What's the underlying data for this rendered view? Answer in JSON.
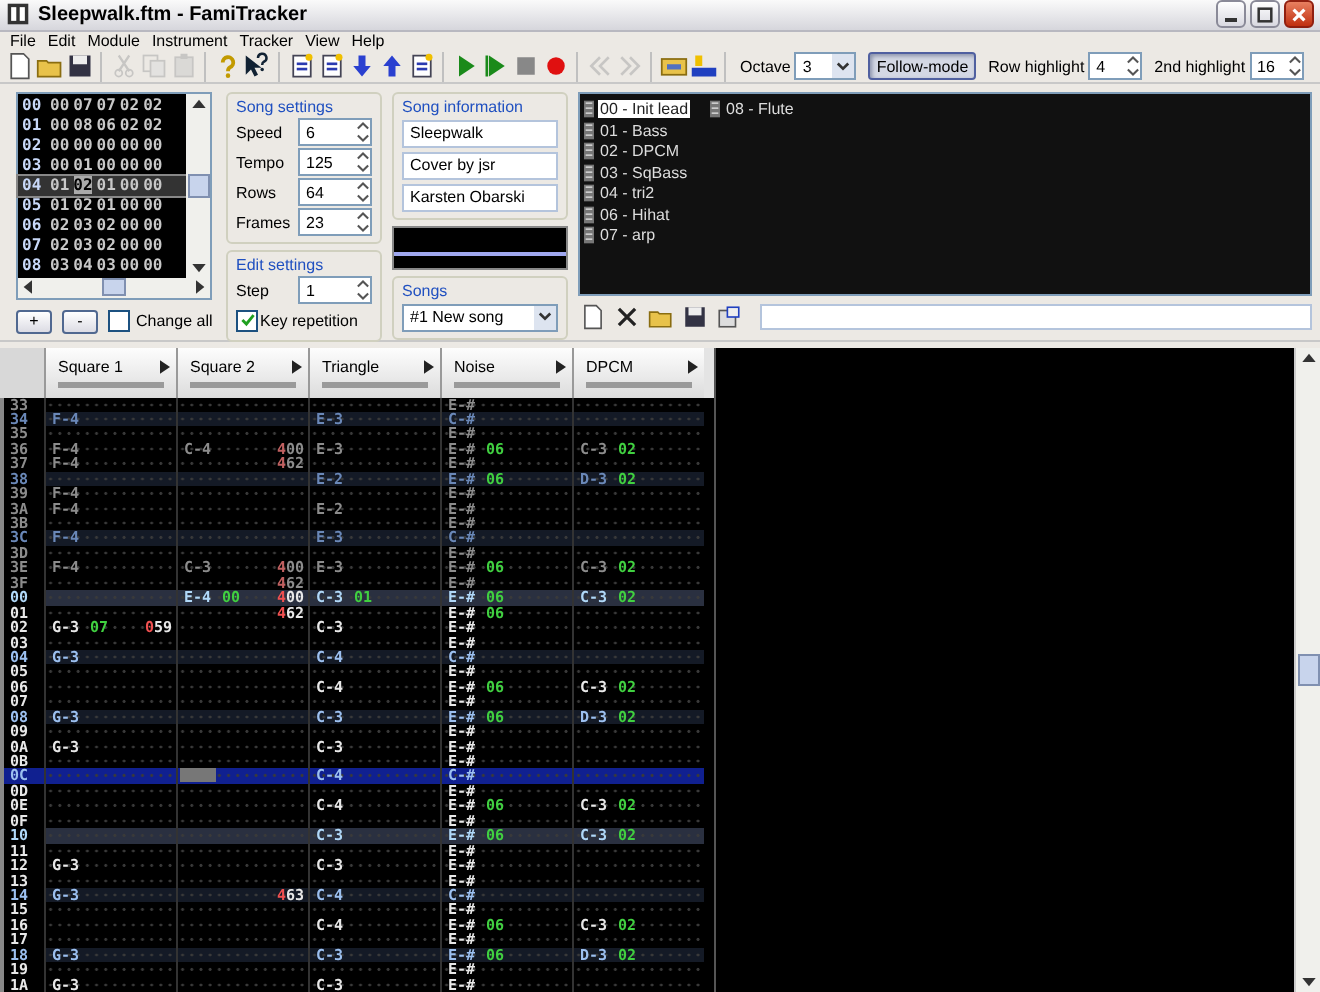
{
  "window": {
    "title": "Sleepwalk.ftm - FamiTracker"
  },
  "menu": [
    "File",
    "Edit",
    "Module",
    "Instrument",
    "Tracker",
    "View",
    "Help"
  ],
  "toolbar": {
    "groups": [
      [
        {
          "kind": "new",
          "disabled": false
        },
        {
          "kind": "open",
          "disabled": false
        },
        {
          "kind": "save",
          "disabled": false
        }
      ],
      [
        {
          "kind": "cut",
          "disabled": true
        },
        {
          "kind": "copy",
          "disabled": true
        },
        {
          "kind": "paste",
          "disabled": true
        }
      ],
      [
        {
          "kind": "about",
          "disabled": false
        },
        {
          "kind": "context-help",
          "disabled": false
        }
      ],
      [
        {
          "kind": "insert-frame",
          "disabled": false
        },
        {
          "kind": "remove-frame",
          "disabled": false
        },
        {
          "kind": "move-down",
          "disabled": false
        },
        {
          "kind": "move-up",
          "disabled": false
        },
        {
          "kind": "duplicate",
          "disabled": false
        }
      ],
      [
        {
          "kind": "play",
          "disabled": false
        },
        {
          "kind": "play-pattern",
          "disabled": false
        },
        {
          "kind": "stop",
          "disabled": false
        },
        {
          "kind": "record",
          "disabled": false
        }
      ],
      [
        {
          "kind": "previous",
          "disabled": true
        },
        {
          "kind": "next",
          "disabled": true
        }
      ],
      [
        {
          "kind": "settings",
          "disabled": false
        },
        {
          "kind": "sample",
          "disabled": false
        }
      ]
    ],
    "octave": {
      "label": "Octave",
      "value": "3"
    },
    "follow_mode": {
      "label": "Follow-mode",
      "on": true
    },
    "row_highlight": {
      "label": "Row highlight",
      "value": "4"
    },
    "second_highlight": {
      "label": "2nd highlight",
      "value": "16"
    }
  },
  "frames": {
    "rows": [
      {
        "number": "00",
        "selected": false,
        "cells": [
          {
            "value": "00",
            "cursor": false
          },
          {
            "value": "07",
            "cursor": false
          },
          {
            "value": "07",
            "cursor": false
          },
          {
            "value": "02",
            "cursor": false
          },
          {
            "value": "02",
            "cursor": false
          }
        ]
      },
      {
        "number": "01",
        "selected": false,
        "cells": [
          {
            "value": "00",
            "cursor": false
          },
          {
            "value": "08",
            "cursor": false
          },
          {
            "value": "06",
            "cursor": false
          },
          {
            "value": "02",
            "cursor": false
          },
          {
            "value": "02",
            "cursor": false
          }
        ]
      },
      {
        "number": "02",
        "selected": false,
        "cells": [
          {
            "value": "00",
            "cursor": false
          },
          {
            "value": "00",
            "cursor": false
          },
          {
            "value": "00",
            "cursor": false
          },
          {
            "value": "00",
            "cursor": false
          },
          {
            "value": "00",
            "cursor": false
          }
        ]
      },
      {
        "number": "03",
        "selected": false,
        "cells": [
          {
            "value": "00",
            "cursor": false
          },
          {
            "value": "01",
            "cursor": false
          },
          {
            "value": "00",
            "cursor": false
          },
          {
            "value": "00",
            "cursor": false
          },
          {
            "value": "00",
            "cursor": false
          }
        ]
      },
      {
        "number": "04",
        "selected": true,
        "cells": [
          {
            "value": "01",
            "cursor": false
          },
          {
            "value": "02",
            "cursor": true
          },
          {
            "value": "01",
            "cursor": false
          },
          {
            "value": "00",
            "cursor": false
          },
          {
            "value": "00",
            "cursor": false
          }
        ]
      },
      {
        "number": "05",
        "selected": false,
        "cells": [
          {
            "value": "01",
            "cursor": false
          },
          {
            "value": "02",
            "cursor": false
          },
          {
            "value": "01",
            "cursor": false
          },
          {
            "value": "00",
            "cursor": false
          },
          {
            "value": "00",
            "cursor": false
          }
        ]
      },
      {
        "number": "06",
        "selected": false,
        "cells": [
          {
            "value": "02",
            "cursor": false
          },
          {
            "value": "03",
            "cursor": false
          },
          {
            "value": "02",
            "cursor": false
          },
          {
            "value": "00",
            "cursor": false
          },
          {
            "value": "00",
            "cursor": false
          }
        ]
      },
      {
        "number": "07",
        "selected": false,
        "cells": [
          {
            "value": "02",
            "cursor": false
          },
          {
            "value": "03",
            "cursor": false
          },
          {
            "value": "02",
            "cursor": false
          },
          {
            "value": "00",
            "cursor": false
          },
          {
            "value": "00",
            "cursor": false
          }
        ]
      },
      {
        "number": "08",
        "selected": false,
        "cells": [
          {
            "value": "03",
            "cursor": false
          },
          {
            "value": "04",
            "cursor": false
          },
          {
            "value": "03",
            "cursor": false
          },
          {
            "value": "00",
            "cursor": false
          },
          {
            "value": "00",
            "cursor": false
          }
        ]
      }
    ],
    "add_button": "+",
    "remove_button": "-",
    "change_all": {
      "label": "Change all",
      "checked": false
    }
  },
  "song_settings": {
    "title": "Song settings",
    "fields": [
      {
        "label": "Speed",
        "value": "6"
      },
      {
        "label": "Tempo",
        "value": "125"
      },
      {
        "label": "Rows",
        "value": "64"
      },
      {
        "label": "Frames",
        "value": "23"
      }
    ]
  },
  "edit_settings": {
    "title": "Edit settings",
    "step": {
      "label": "Step",
      "value": "1"
    },
    "key_repetition": {
      "label": "Key repetition",
      "checked": true
    }
  },
  "song_information": {
    "title": "Song information",
    "fields": [
      "Sleepwalk",
      "Cover by jsr",
      "Karsten Obarski"
    ]
  },
  "songs": {
    "title": "Songs",
    "value": "#1 New song"
  },
  "instruments": [
    {
      "label": "00 - Init lead",
      "selected": true
    },
    {
      "label": "01 - Bass",
      "selected": false
    },
    {
      "label": "02 - DPCM",
      "selected": false
    },
    {
      "label": "03 - SqBass",
      "selected": false
    },
    {
      "label": "04 - tri2",
      "selected": false
    },
    {
      "label": "06 - Hihat",
      "selected": false
    },
    {
      "label": "07 - arp",
      "selected": false
    },
    {
      "label": "08 - Flute",
      "selected": false
    }
  ],
  "pattern": {
    "channels": [
      "Square 1",
      "Square 2",
      "Triangle",
      "Noise",
      "DPCM"
    ],
    "rows": [
      {
        "number": "33",
        "dimmed": true,
        "highlighted": false,
        "bar_start": false,
        "selected": false,
        "cells": [
          null,
          null,
          null,
          {
            "note": "E-#"
          },
          null
        ]
      },
      {
        "number": "34",
        "dimmed": true,
        "highlighted": true,
        "bar_start": false,
        "selected": false,
        "cells": [
          {
            "note": "F-4"
          },
          null,
          {
            "note": "E-3"
          },
          {
            "note": "C-#"
          },
          null
        ]
      },
      {
        "number": "35",
        "dimmed": true,
        "highlighted": false,
        "bar_start": false,
        "selected": false,
        "cells": [
          null,
          null,
          null,
          {
            "note": "E-#"
          },
          null
        ]
      },
      {
        "number": "36",
        "dimmed": true,
        "highlighted": false,
        "bar_start": false,
        "selected": false,
        "cells": [
          {
            "note": "F-4"
          },
          {
            "note": "C-4",
            "effect": "400"
          },
          {
            "note": "E-3"
          },
          {
            "note": "E-#",
            "instrument": "06"
          },
          {
            "note": "C-3",
            "instrument": "02"
          }
        ]
      },
      {
        "number": "37",
        "dimmed": true,
        "highlighted": false,
        "bar_start": false,
        "selected": false,
        "cells": [
          {
            "note": "F-4"
          },
          {
            "effect": "462"
          },
          null,
          {
            "note": "E-#"
          },
          null
        ]
      },
      {
        "number": "38",
        "dimmed": true,
        "highlighted": true,
        "bar_start": false,
        "selected": false,
        "cells": [
          null,
          null,
          {
            "note": "E-2"
          },
          {
            "note": "E-#",
            "instrument": "06"
          },
          {
            "note": "D-3",
            "instrument": "02"
          }
        ]
      },
      {
        "number": "39",
        "dimmed": true,
        "highlighted": false,
        "bar_start": false,
        "selected": false,
        "cells": [
          {
            "note": "F-4"
          },
          null,
          null,
          {
            "note": "E-#"
          },
          null
        ]
      },
      {
        "number": "3A",
        "dimmed": true,
        "highlighted": false,
        "bar_start": false,
        "selected": false,
        "cells": [
          {
            "note": "F-4"
          },
          null,
          {
            "note": "E-2"
          },
          {
            "note": "E-#"
          },
          null
        ]
      },
      {
        "number": "3B",
        "dimmed": true,
        "highlighted": false,
        "bar_start": false,
        "selected": false,
        "cells": [
          null,
          null,
          null,
          {
            "note": "E-#"
          },
          null
        ]
      },
      {
        "number": "3C",
        "dimmed": true,
        "highlighted": true,
        "bar_start": false,
        "selected": false,
        "cells": [
          {
            "note": "F-4"
          },
          null,
          {
            "note": "E-3"
          },
          {
            "note": "C-#"
          },
          null
        ]
      },
      {
        "number": "3D",
        "dimmed": true,
        "highlighted": false,
        "bar_start": false,
        "selected": false,
        "cells": [
          null,
          null,
          null,
          {
            "note": "E-#"
          },
          null
        ]
      },
      {
        "number": "3E",
        "dimmed": true,
        "highlighted": false,
        "bar_start": false,
        "selected": false,
        "cells": [
          {
            "note": "F-4"
          },
          {
            "note": "C-3",
            "effect": "400"
          },
          {
            "note": "E-3"
          },
          {
            "note": "E-#",
            "instrument": "06"
          },
          {
            "note": "C-3",
            "instrument": "02"
          }
        ]
      },
      {
        "number": "3F",
        "dimmed": true,
        "highlighted": false,
        "bar_start": false,
        "selected": false,
        "cells": [
          null,
          {
            "effect": "462"
          },
          null,
          {
            "note": "E-#"
          },
          null
        ]
      },
      {
        "number": "00",
        "dimmed": false,
        "highlighted": true,
        "bar_start": true,
        "selected": false,
        "cells": [
          null,
          {
            "note": "E-4",
            "instrument": "00",
            "effect": "400"
          },
          {
            "note": "C-3",
            "instrument": "01"
          },
          {
            "note": "E-#",
            "instrument": "06"
          },
          {
            "note": "C-3",
            "instrument": "02"
          }
        ]
      },
      {
        "number": "01",
        "dimmed": false,
        "highlighted": false,
        "bar_start": false,
        "selected": false,
        "cells": [
          null,
          {
            "effect": "462"
          },
          null,
          {
            "note": "E-#",
            "instrument": "06"
          },
          null
        ]
      },
      {
        "number": "02",
        "dimmed": false,
        "highlighted": false,
        "bar_start": false,
        "selected": false,
        "cells": [
          {
            "note": "G-3",
            "instrument": "07",
            "effect": "059"
          },
          null,
          {
            "note": "C-3"
          },
          {
            "note": "E-#"
          },
          null
        ]
      },
      {
        "number": "03",
        "dimmed": false,
        "highlighted": false,
        "bar_start": false,
        "selected": false,
        "cells": [
          null,
          null,
          null,
          {
            "note": "E-#"
          },
          null
        ]
      },
      {
        "number": "04",
        "dimmed": false,
        "highlighted": true,
        "bar_start": false,
        "selected": false,
        "cells": [
          {
            "note": "G-3"
          },
          null,
          {
            "note": "C-4"
          },
          {
            "note": "C-#"
          },
          null
        ]
      },
      {
        "number": "05",
        "dimmed": false,
        "highlighted": false,
        "bar_start": false,
        "selected": false,
        "cells": [
          null,
          null,
          null,
          {
            "note": "E-#"
          },
          null
        ]
      },
      {
        "number": "06",
        "dimmed": false,
        "highlighted": false,
        "bar_start": false,
        "selected": false,
        "cells": [
          null,
          null,
          {
            "note": "C-4"
          },
          {
            "note": "E-#",
            "instrument": "06"
          },
          {
            "note": "C-3",
            "instrument": "02"
          }
        ]
      },
      {
        "number": "07",
        "dimmed": false,
        "highlighted": false,
        "bar_start": false,
        "selected": false,
        "cells": [
          null,
          null,
          null,
          {
            "note": "E-#"
          },
          null
        ]
      },
      {
        "number": "08",
        "dimmed": false,
        "highlighted": true,
        "bar_start": false,
        "selected": false,
        "cells": [
          {
            "note": "G-3"
          },
          null,
          {
            "note": "C-3"
          },
          {
            "note": "E-#",
            "instrument": "06"
          },
          {
            "note": "D-3",
            "instrument": "02"
          }
        ]
      },
      {
        "number": "09",
        "dimmed": false,
        "highlighted": false,
        "bar_start": false,
        "selected": false,
        "cells": [
          null,
          null,
          null,
          {
            "note": "E-#"
          },
          null
        ]
      },
      {
        "number": "0A",
        "dimmed": false,
        "highlighted": false,
        "bar_start": false,
        "selected": false,
        "cells": [
          {
            "note": "G-3"
          },
          null,
          {
            "note": "C-3"
          },
          {
            "note": "E-#"
          },
          null
        ]
      },
      {
        "number": "0B",
        "dimmed": false,
        "highlighted": false,
        "bar_start": false,
        "selected": false,
        "cells": [
          null,
          null,
          null,
          {
            "note": "E-#"
          },
          null
        ]
      },
      {
        "number": "0C",
        "dimmed": false,
        "highlighted": true,
        "bar_start": false,
        "selected": true,
        "cells": [
          null,
          {
            "cursor": true
          },
          {
            "note": "C-4"
          },
          {
            "note": "C-#"
          },
          null
        ]
      },
      {
        "number": "0D",
        "dimmed": false,
        "highlighted": false,
        "bar_start": false,
        "selected": false,
        "cells": [
          null,
          null,
          null,
          {
            "note": "E-#"
          },
          null
        ]
      },
      {
        "number": "0E",
        "dimmed": false,
        "highlighted": false,
        "bar_start": false,
        "selected": false,
        "cells": [
          null,
          null,
          {
            "note": "C-4"
          },
          {
            "note": "E-#",
            "instrument": "06"
          },
          {
            "note": "C-3",
            "instrument": "02"
          }
        ]
      },
      {
        "number": "0F",
        "dimmed": false,
        "highlighted": false,
        "bar_start": false,
        "selected": false,
        "cells": [
          null,
          null,
          null,
          {
            "note": "E-#"
          },
          null
        ]
      },
      {
        "number": "10",
        "dimmed": false,
        "highlighted": true,
        "bar_start": true,
        "selected": false,
        "cells": [
          null,
          null,
          {
            "note": "C-3"
          },
          {
            "note": "E-#",
            "instrument": "06"
          },
          {
            "note": "C-3",
            "instrument": "02"
          }
        ]
      },
      {
        "number": "11",
        "dimmed": false,
        "highlighted": false,
        "bar_start": false,
        "selected": false,
        "cells": [
          null,
          null,
          null,
          {
            "note": "E-#"
          },
          null
        ]
      },
      {
        "number": "12",
        "dimmed": false,
        "highlighted": false,
        "bar_start": false,
        "selected": false,
        "cells": [
          {
            "note": "G-3"
          },
          null,
          {
            "note": "C-3"
          },
          {
            "note": "E-#"
          },
          null
        ]
      },
      {
        "number": "13",
        "dimmed": false,
        "highlighted": false,
        "bar_start": false,
        "selected": false,
        "cells": [
          null,
          null,
          null,
          {
            "note": "E-#"
          },
          null
        ]
      },
      {
        "number": "14",
        "dimmed": false,
        "highlighted": true,
        "bar_start": false,
        "selected": false,
        "cells": [
          {
            "note": "G-3"
          },
          {
            "effect": "463"
          },
          {
            "note": "C-4"
          },
          {
            "note": "C-#"
          },
          null
        ]
      },
      {
        "number": "15",
        "dimmed": false,
        "highlighted": false,
        "bar_start": false,
        "selected": false,
        "cells": [
          null,
          null,
          null,
          {
            "note": "E-#"
          },
          null
        ]
      },
      {
        "number": "16",
        "dimmed": false,
        "highlighted": false,
        "bar_start": false,
        "selected": false,
        "cells": [
          null,
          null,
          {
            "note": "C-4"
          },
          {
            "note": "E-#",
            "instrument": "06"
          },
          {
            "note": "C-3",
            "instrument": "02"
          }
        ]
      },
      {
        "number": "17",
        "dimmed": false,
        "highlighted": false,
        "bar_start": false,
        "selected": false,
        "cells": [
          null,
          null,
          null,
          {
            "note": "E-#"
          },
          null
        ]
      },
      {
        "number": "18",
        "dimmed": false,
        "highlighted": true,
        "bar_start": false,
        "selected": false,
        "cells": [
          {
            "note": "G-3"
          },
          null,
          {
            "note": "C-3"
          },
          {
            "note": "E-#",
            "instrument": "06"
          },
          {
            "note": "D-3",
            "instrument": "02"
          }
        ]
      },
      {
        "number": "19",
        "dimmed": false,
        "highlighted": false,
        "bar_start": false,
        "selected": false,
        "cells": [
          null,
          null,
          null,
          {
            "note": "E-#"
          },
          null
        ]
      },
      {
        "number": "1A",
        "dimmed": false,
        "highlighted": false,
        "bar_start": false,
        "selected": false,
        "cells": [
          {
            "note": "G-3"
          },
          null,
          {
            "note": "C-3"
          },
          {
            "note": "E-#"
          },
          null
        ]
      }
    ]
  }
}
